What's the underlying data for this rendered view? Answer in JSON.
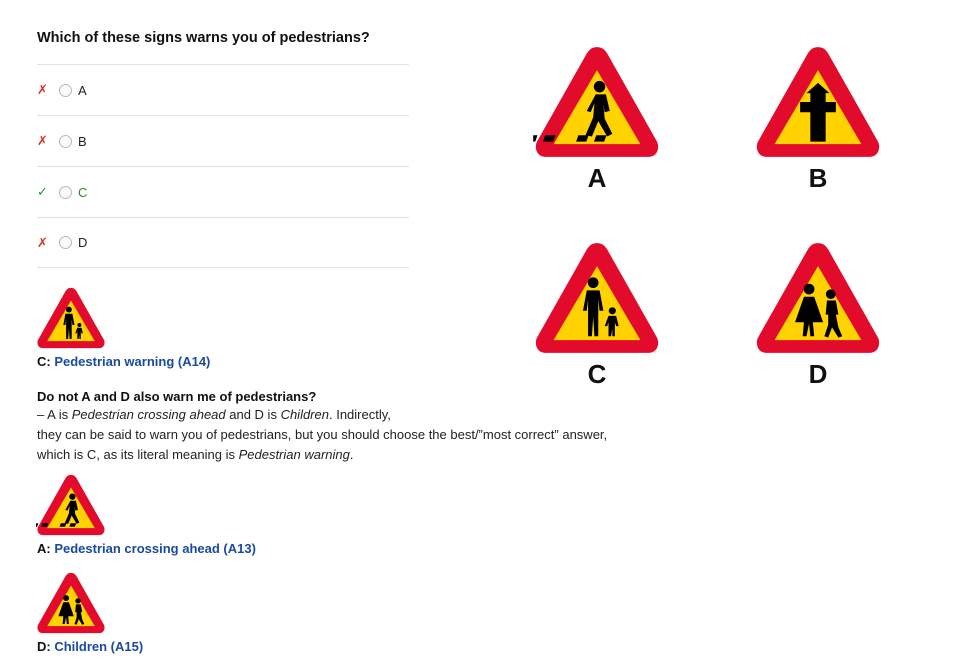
{
  "question": "Which of these signs warns you of pedestrians?",
  "options": [
    {
      "mark": "✗",
      "label": "A",
      "correct": false
    },
    {
      "mark": "✗",
      "label": "B",
      "correct": false
    },
    {
      "mark": "✓",
      "label": "C",
      "correct": true
    },
    {
      "mark": "✗",
      "label": "D",
      "correct": false
    }
  ],
  "answer_c": {
    "prefix": "C: ",
    "link": "Pedestrian warning (A14)"
  },
  "explanation": {
    "heading": "Do not A and D also warn me of pedestrians?",
    "t1": "– A is ",
    "t2": "Pedestrian crossing ahead",
    "t3": " and D is ",
    "t4": "Children",
    "t5": ". Indirectly,",
    "t6": "they can be said to warn you of pedestrians, but you should choose the best/”most correct” answer,",
    "t7": "which is C, as its literal meaning is ",
    "t8": "Pedestrian warning",
    "t9": "."
  },
  "answer_a": {
    "prefix": "A: ",
    "link": "Pedestrian crossing ahead (A13)"
  },
  "answer_d": {
    "prefix": "D: ",
    "link": "Children (A15)"
  },
  "big_signs": [
    {
      "letter": "A",
      "icon": "pedestrian-crossing-sign-icon"
    },
    {
      "letter": "B",
      "icon": "crossroads-sign-icon"
    },
    {
      "letter": "C",
      "icon": "pedestrian-warning-sign-icon"
    },
    {
      "letter": "D",
      "icon": "children-sign-icon"
    }
  ],
  "colors": {
    "sign_red": "#e30b2b",
    "sign_yellow": "#ffd200",
    "link_blue": "#1a4aa0",
    "wrong_red": "#d9342b",
    "right_green": "#2e8b2e"
  }
}
